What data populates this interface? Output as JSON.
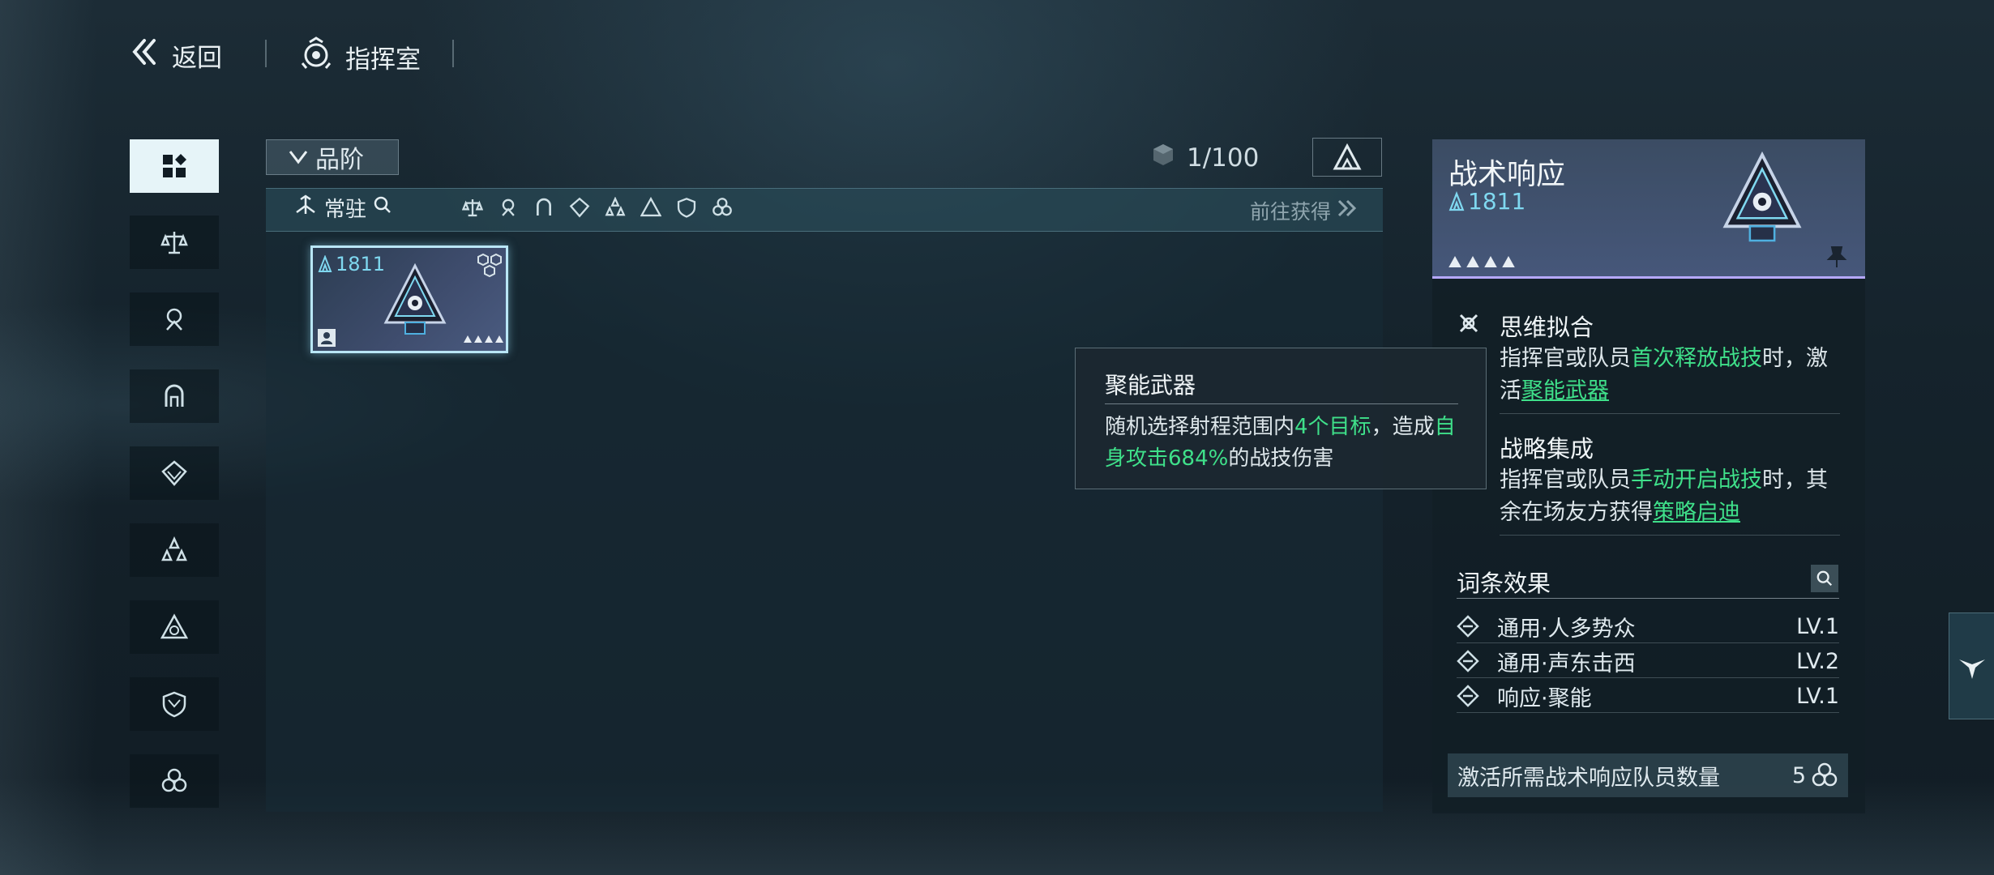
{
  "topbar": {
    "back_label": "返回",
    "room_label": "指挥室"
  },
  "filter": {
    "grade_label": "品阶",
    "count": "1/100",
    "tab_label": "常驻",
    "goto_label": "前往获得"
  },
  "card": {
    "power": "1811"
  },
  "tooltip": {
    "title": "聚能武器",
    "desc_pre": "随机选择射程范围内",
    "desc_hl1": "4个目标",
    "desc_mid": "，造成",
    "desc_hl2": "自身攻击684%",
    "desc_post": "的战技伤害"
  },
  "detail": {
    "title": "战术响应",
    "power": "1811",
    "skills": [
      {
        "name": "思维拟合",
        "pre": "指挥官或队员",
        "hl": "首次释放战技",
        "mid": "时，激活",
        "link": "聚能武器",
        "post": ""
      },
      {
        "name": "战略集成",
        "pre": "指挥官或队员",
        "hl": "手动开启战技",
        "mid": "时，其余在场友方获得",
        "link": "策略启迪",
        "post": ""
      }
    ],
    "affix_title": "词条效果",
    "affixes": [
      {
        "name": "通用·人多势众",
        "level": "LV.1"
      },
      {
        "name": "通用·声东击西",
        "level": "LV.2"
      },
      {
        "name": "响应·聚能",
        "level": "LV.1"
      }
    ],
    "activation_label": "激活所需战术响应队员数量",
    "activation_count": "5"
  },
  "colors": {
    "accent_green": "#3fe08a",
    "accent_cyan": "#7fd8f0",
    "rarity_purple": "#b6a8ff"
  },
  "icons": {
    "sidebar": [
      "all-grid-icon",
      "faction-scale-icon",
      "faction-diver-icon",
      "faction-arch-icon",
      "faction-diamond-icon",
      "faction-tri-icon",
      "faction-delta-icon",
      "faction-shield-icon",
      "faction-trefoil-icon"
    ]
  }
}
